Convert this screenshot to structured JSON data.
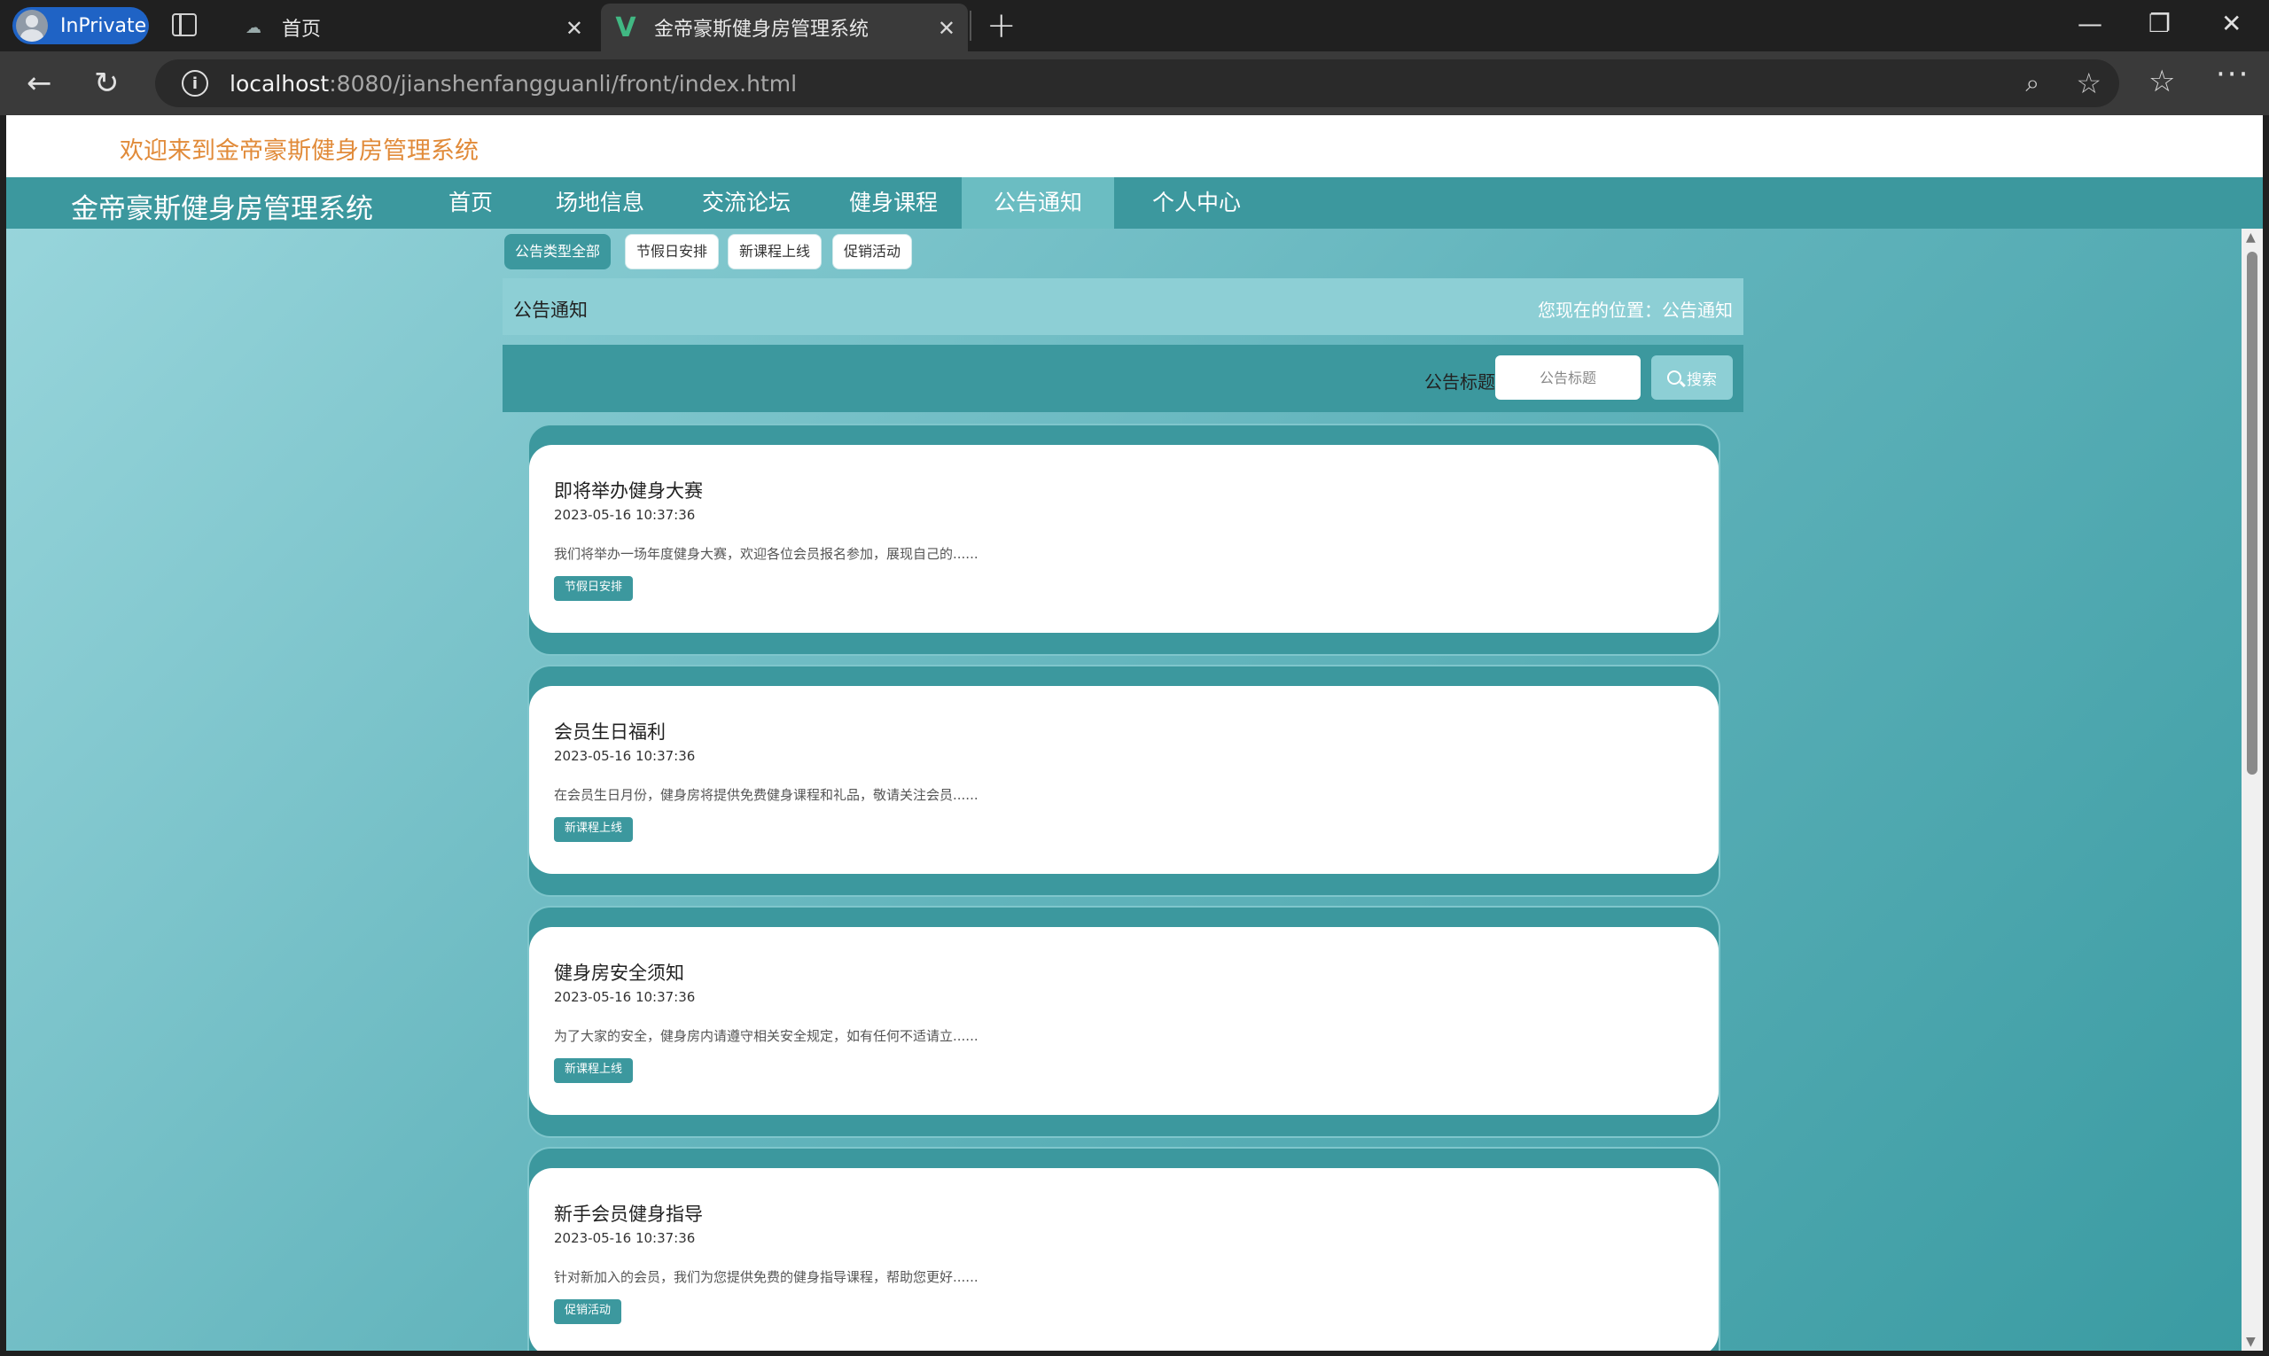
{
  "browser": {
    "inprivate_label": "InPrivate",
    "tabs": [
      {
        "title": "首页"
      },
      {
        "title": "金帝豪斯健身房管理系统"
      }
    ],
    "url_host": "localhost",
    "url_path": ":8080/jianshenfangguanli/front/index.html"
  },
  "site": {
    "welcome": "欢迎来到金帝豪斯健身房管理系统",
    "brand": "金帝豪斯健身房管理系统",
    "nav": [
      {
        "label": "首页"
      },
      {
        "label": "场地信息"
      },
      {
        "label": "交流论坛"
      },
      {
        "label": "健身课程"
      },
      {
        "label": "公告通知"
      },
      {
        "label": "个人中心"
      }
    ]
  },
  "filters": [
    {
      "label": "公告类型全部"
    },
    {
      "label": "节假日安排"
    },
    {
      "label": "新课程上线"
    },
    {
      "label": "促销活动"
    }
  ],
  "breadcrumb": {
    "title": "公告通知",
    "location": "您现在的位置：公告通知"
  },
  "search": {
    "label": "公告标题",
    "placeholder": "公告标题",
    "button": "搜索"
  },
  "notices": [
    {
      "title": "即将举办健身大赛",
      "date": "2023-05-16 10:37:36",
      "summary": "我们将举办一场年度健身大赛，欢迎各位会员报名参加，展现自己的......",
      "tag": "节假日安排"
    },
    {
      "title": "会员生日福利",
      "date": "2023-05-16 10:37:36",
      "summary": "在会员生日月份，健身房将提供免费健身课程和礼品，敬请关注会员......",
      "tag": "新课程上线"
    },
    {
      "title": "健身房安全须知",
      "date": "2023-05-16 10:37:36",
      "summary": "为了大家的安全，健身房内请遵守相关安全规定，如有任何不适请立......",
      "tag": "新课程上线"
    },
    {
      "title": "新手会员健身指导",
      "date": "2023-05-16 10:37:36",
      "summary": "针对新加入的会员，我们为您提供免费的健身指导课程，帮助您更好......",
      "tag": "促销活动"
    }
  ]
}
